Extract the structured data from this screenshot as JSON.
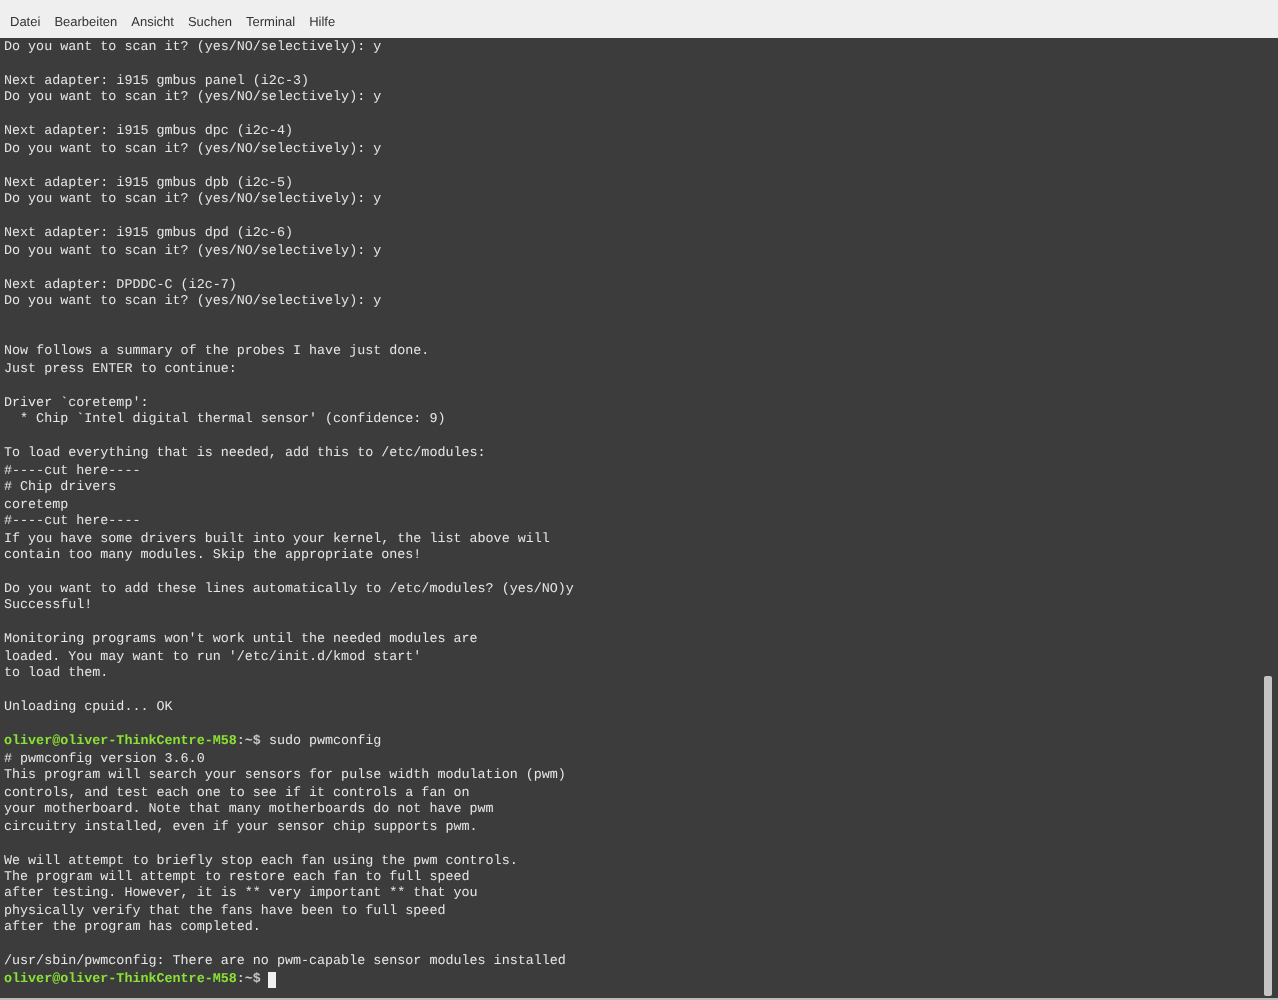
{
  "menu": [
    "Datei",
    "Bearbeiten",
    "Ansicht",
    "Suchen",
    "Terminal",
    "Hilfe"
  ],
  "terminal": {
    "lines": [
      {
        "kind": "output",
        "text": "Do you want to scan it? (yes/NO/selectively): y"
      },
      {
        "kind": "blank"
      },
      {
        "kind": "output",
        "text": "Next adapter: i915 gmbus panel (i2c-3)"
      },
      {
        "kind": "output",
        "text": "Do you want to scan it? (yes/NO/selectively): y"
      },
      {
        "kind": "blank"
      },
      {
        "kind": "output",
        "text": "Next adapter: i915 gmbus dpc (i2c-4)"
      },
      {
        "kind": "output",
        "text": "Do you want to scan it? (yes/NO/selectively): y"
      },
      {
        "kind": "blank"
      },
      {
        "kind": "output",
        "text": "Next adapter: i915 gmbus dpb (i2c-5)"
      },
      {
        "kind": "output",
        "text": "Do you want to scan it? (yes/NO/selectively): y"
      },
      {
        "kind": "blank"
      },
      {
        "kind": "output",
        "text": "Next adapter: i915 gmbus dpd (i2c-6)"
      },
      {
        "kind": "output",
        "text": "Do you want to scan it? (yes/NO/selectively): y"
      },
      {
        "kind": "blank"
      },
      {
        "kind": "output",
        "text": "Next adapter: DPDDC-C (i2c-7)"
      },
      {
        "kind": "output",
        "text": "Do you want to scan it? (yes/NO/selectively): y"
      },
      {
        "kind": "blank"
      },
      {
        "kind": "blank"
      },
      {
        "kind": "output",
        "text": "Now follows a summary of the probes I have just done."
      },
      {
        "kind": "output",
        "text": "Just press ENTER to continue:"
      },
      {
        "kind": "blank"
      },
      {
        "kind": "output",
        "text": "Driver `coretemp':"
      },
      {
        "kind": "output",
        "text": "  * Chip `Intel digital thermal sensor' (confidence: 9)"
      },
      {
        "kind": "blank"
      },
      {
        "kind": "output",
        "text": "To load everything that is needed, add this to /etc/modules:"
      },
      {
        "kind": "output",
        "text": "#----cut here----"
      },
      {
        "kind": "output",
        "text": "# Chip drivers"
      },
      {
        "kind": "output",
        "text": "coretemp"
      },
      {
        "kind": "output",
        "text": "#----cut here----"
      },
      {
        "kind": "output",
        "text": "If you have some drivers built into your kernel, the list above will"
      },
      {
        "kind": "output",
        "text": "contain too many modules. Skip the appropriate ones!"
      },
      {
        "kind": "blank"
      },
      {
        "kind": "output",
        "text": "Do you want to add these lines automatically to /etc/modules? (yes/NO)y"
      },
      {
        "kind": "output",
        "text": "Successful!"
      },
      {
        "kind": "blank"
      },
      {
        "kind": "output",
        "text": "Monitoring programs won't work until the needed modules are"
      },
      {
        "kind": "output",
        "text": "loaded. You may want to run '/etc/init.d/kmod start'"
      },
      {
        "kind": "output",
        "text": "to load them."
      },
      {
        "kind": "blank"
      },
      {
        "kind": "output",
        "text": "Unloading cpuid... OK"
      },
      {
        "kind": "blank"
      },
      {
        "kind": "prompt",
        "user_host": "oliver@oliver-ThinkCentre-M58",
        "path": ":~$",
        "command": "sudo pwmconfig",
        "cursor": false
      },
      {
        "kind": "output",
        "text": "# pwmconfig version 3.6.0"
      },
      {
        "kind": "output",
        "text": "This program will search your sensors for pulse width modulation (pwm)"
      },
      {
        "kind": "output",
        "text": "controls, and test each one to see if it controls a fan on"
      },
      {
        "kind": "output",
        "text": "your motherboard. Note that many motherboards do not have pwm"
      },
      {
        "kind": "output",
        "text": "circuitry installed, even if your sensor chip supports pwm."
      },
      {
        "kind": "blank"
      },
      {
        "kind": "output",
        "text": "We will attempt to briefly stop each fan using the pwm controls."
      },
      {
        "kind": "output",
        "text": "The program will attempt to restore each fan to full speed"
      },
      {
        "kind": "output",
        "text": "after testing. However, it is ** very important ** that you"
      },
      {
        "kind": "output",
        "text": "physically verify that the fans have been to full speed"
      },
      {
        "kind": "output",
        "text": "after the program has completed."
      },
      {
        "kind": "blank"
      },
      {
        "kind": "output",
        "text": "/usr/sbin/pwmconfig: There are no pwm-capable sensor modules installed"
      },
      {
        "kind": "prompt",
        "user_host": "oliver@oliver-ThinkCentre-M58",
        "path": ":~$",
        "cursor": true
      }
    ]
  }
}
